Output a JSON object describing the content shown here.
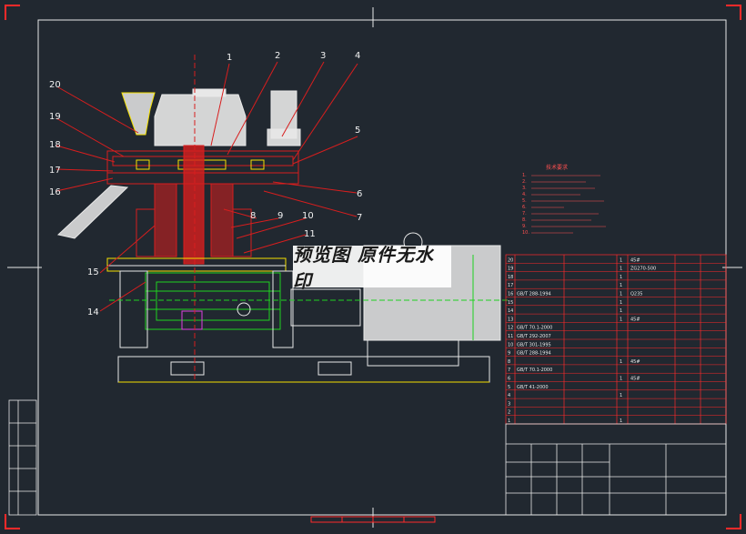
{
  "watermark": "预览图 原件无水印",
  "callouts": [
    "1",
    "2",
    "3",
    "4",
    "5",
    "6",
    "7",
    "8",
    "9",
    "10",
    "11",
    "14",
    "15",
    "16",
    "17",
    "18",
    "19",
    "20"
  ],
  "notes_title": "技术要求",
  "notes": [
    "1.",
    "2.",
    "3.",
    "4.",
    "5.",
    "6.",
    "7.",
    "8.",
    "9.",
    "10."
  ],
  "bom": {
    "rows": [
      {
        "no": "20",
        "std": "",
        "name": "",
        "qty": "1",
        "mat": "45#"
      },
      {
        "no": "19",
        "std": "",
        "name": "",
        "qty": "1",
        "mat": "ZG270-500"
      },
      {
        "no": "18",
        "std": "",
        "name": "",
        "qty": "1",
        "mat": ""
      },
      {
        "no": "17",
        "std": "",
        "name": "",
        "qty": "1",
        "mat": ""
      },
      {
        "no": "16",
        "std": "GB/T 288-1994",
        "name": "",
        "qty": "1",
        "mat": "Q235"
      },
      {
        "no": "15",
        "std": "",
        "name": "",
        "qty": "1",
        "mat": ""
      },
      {
        "no": "14",
        "std": "",
        "name": "",
        "qty": "1",
        "mat": ""
      },
      {
        "no": "13",
        "std": "",
        "name": "",
        "qty": "1",
        "mat": "45#"
      },
      {
        "no": "12",
        "std": "GB/T 70.1-2000",
        "name": "",
        "qty": "",
        "mat": ""
      },
      {
        "no": "11",
        "std": "GB/T 292-2007",
        "name": "",
        "qty": "",
        "mat": ""
      },
      {
        "no": "10",
        "std": "GB/T 301-1995",
        "name": "",
        "qty": "",
        "mat": ""
      },
      {
        "no": "9",
        "std": "GB/T 288-1994",
        "name": "",
        "qty": "",
        "mat": ""
      },
      {
        "no": "8",
        "std": "",
        "name": "",
        "qty": "1",
        "mat": "45#"
      },
      {
        "no": "7",
        "std": "GB/T 70.1-2000",
        "name": "",
        "qty": "",
        "mat": ""
      },
      {
        "no": "6",
        "std": "",
        "name": "",
        "qty": "1",
        "mat": "45#"
      },
      {
        "no": "5",
        "std": "GB/T 41-2000",
        "name": "",
        "qty": "",
        "mat": ""
      },
      {
        "no": "4",
        "std": "",
        "name": "",
        "qty": "1",
        "mat": ""
      },
      {
        "no": "3",
        "std": "",
        "name": "",
        "qty": "",
        "mat": ""
      },
      {
        "no": "2",
        "std": "",
        "name": "",
        "qty": "",
        "mat": ""
      },
      {
        "no": "1",
        "std": "",
        "name": "",
        "qty": "1",
        "mat": ""
      }
    ]
  },
  "left_stamp": [
    "",
    "",
    "",
    "",
    ""
  ],
  "colors": {
    "bg": "#212830",
    "border": "#e8e8e8",
    "frame_red": "#ff2a2a",
    "part_red": "#d81e1e",
    "green": "#1fd21f",
    "yellow": "#f5e100",
    "magenta": "#e040e0",
    "cyan": "#24d4e0"
  }
}
